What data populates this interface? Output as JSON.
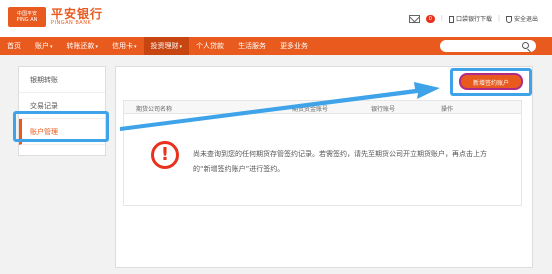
{
  "logo": {
    "badge_line1": "中国平安",
    "badge_line2": "PING AN",
    "name_cn": "平安银行",
    "name_en": "PINGAN BANK"
  },
  "top_links": {
    "mail_count": "0",
    "download": "口袋银行下载",
    "security": "安全退出"
  },
  "nav": {
    "items": [
      {
        "label": "首页",
        "caret": false
      },
      {
        "label": "账户",
        "caret": true
      },
      {
        "label": "转账还款",
        "caret": true
      },
      {
        "label": "信用卡",
        "caret": true
      },
      {
        "label": "投资理财",
        "caret": true
      },
      {
        "label": "个人贷款",
        "caret": false
      },
      {
        "label": "生活服务",
        "caret": false
      },
      {
        "label": "更多业务",
        "caret": false
      }
    ],
    "active_index": 4
  },
  "search": {
    "placeholder": ""
  },
  "sidebar": {
    "items": [
      "银期转账",
      "交易记录",
      "账户管理"
    ],
    "active_index": 2
  },
  "main": {
    "new_button": "新增签约账户",
    "table_headers": [
      "期货公司名称",
      "期货资金账号",
      "银行账号",
      "操作"
    ],
    "empty_message": "尚未查询到您的任何期货存管签约记录。若需签约，请先至期货公司开立期货账户，再点击上方的“新增签约账户”进行签约。",
    "warn_glyph": "!"
  },
  "colors": {
    "brand": "#e85a1e",
    "highlight": "#3ea3e8",
    "warning": "#e8321e"
  }
}
